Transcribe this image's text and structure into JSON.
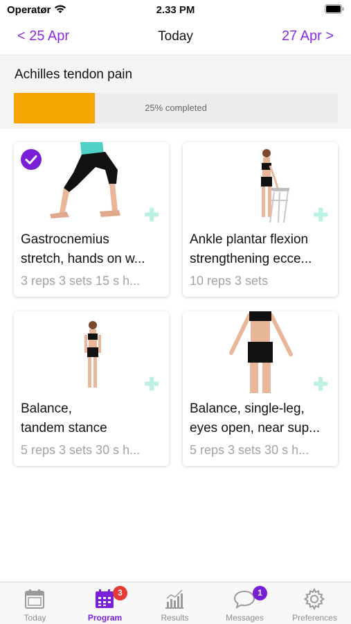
{
  "status_bar": {
    "carrier": "Operatør",
    "time": "2.33 PM"
  },
  "nav": {
    "prev_label": "< 25 Apr",
    "title": "Today",
    "next_label": "27 Apr >"
  },
  "program": {
    "condition": "Achilles tendon pain",
    "progress_text": "25% completed",
    "progress_fraction": 0.25
  },
  "exercises": [
    {
      "name_line1": "Gastrocnemius",
      "name_line2": "stretch, hands on w...",
      "reps": "3 reps 3 sets 15 s h...",
      "completed": true,
      "add_icon": "plus-icon"
    },
    {
      "name_line1": "Ankle plantar flexion",
      "name_line2": "strengthening ecce...",
      "reps": "10 reps 3 sets",
      "completed": false,
      "add_icon": "plus-icon"
    },
    {
      "name_line1": "Balance,",
      "name_line2": "tandem stance",
      "reps": "5 reps 3 sets 30 s h...",
      "completed": false,
      "add_icon": "plus-icon"
    },
    {
      "name_line1": "Balance, single-leg,",
      "name_line2": "eyes open, near sup...",
      "reps": "5 reps 3 sets 30 s h...",
      "completed": false,
      "add_icon": "plus-icon"
    }
  ],
  "tabs": [
    {
      "label": "Today",
      "icon": "calendar-icon",
      "active": false
    },
    {
      "label": "Program",
      "icon": "calendar-grid-icon",
      "active": true,
      "badge": "3"
    },
    {
      "label": "Results",
      "icon": "chart-icon",
      "active": false
    },
    {
      "label": "Messages",
      "icon": "chat-bubble-icon",
      "active": false,
      "badge": "1"
    },
    {
      "label": "Preferences",
      "icon": "gear-icon",
      "active": false
    }
  ],
  "colors": {
    "accent": "#7a1fd8",
    "progress": "#f5a500",
    "badge_red": "#e53935",
    "plus_mint": "#bdf0e4"
  }
}
